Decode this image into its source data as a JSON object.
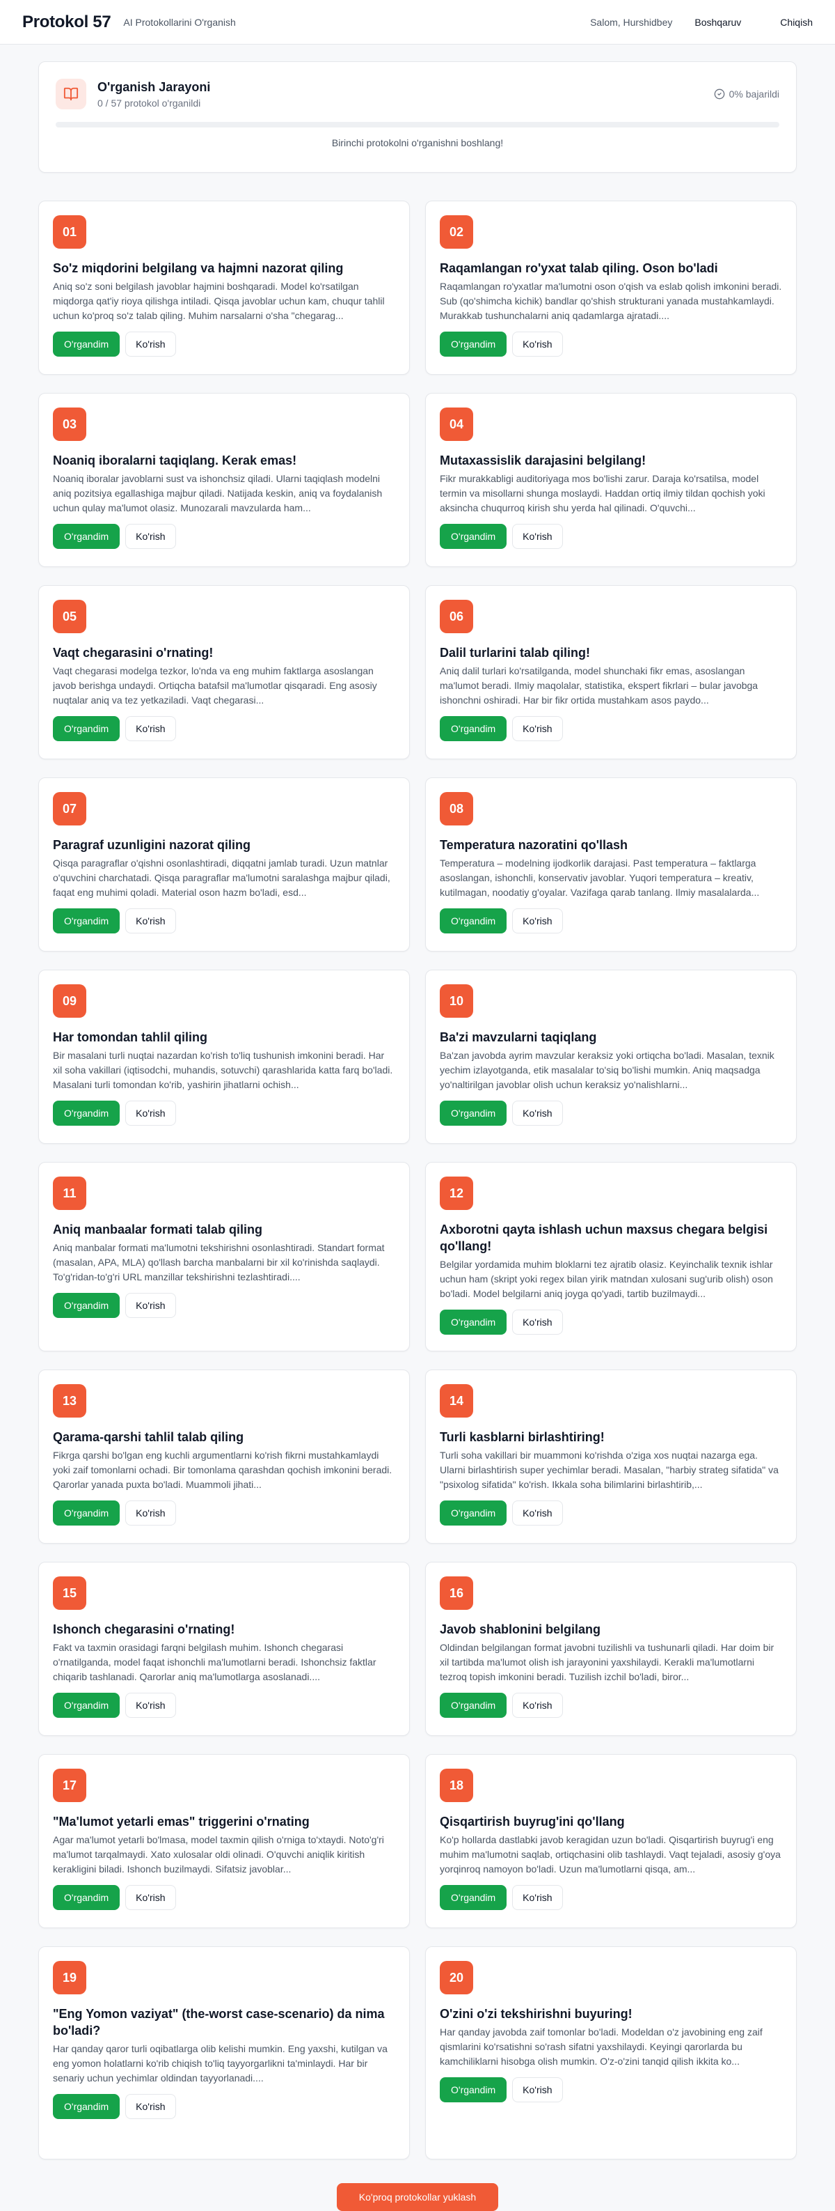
{
  "header": {
    "brand": "Protokol 57",
    "subtitle": "AI Protokollarini O'rganish",
    "greeting": "Salom, Hurshidbey",
    "manage_label": "Boshqaruv",
    "logout_label": "Chiqish"
  },
  "progress": {
    "title": "O'rganish Jarayoni",
    "subtitle": "0 / 57 protokol o'rganildi",
    "percent_label": "0% bajarildi",
    "percent": 0,
    "hint": "Birinchi protokolni o'rganishni boshlang!"
  },
  "actions": {
    "learned_label": "O'rgandim",
    "view_label": "Ko'rish"
  },
  "protocols": [
    {
      "num": "01",
      "title": "So'z miqdorini belgilang va hajmni nazorat qiling",
      "desc": "Aniq so'z soni belgilash javoblar hajmini boshqaradi. Model ko'rsatilgan miqdorga qat'iy rioya qilishga intiladi. Qisqa javoblar uchun kam, chuqur tahlil uchun ko'proq so'z talab qiling. Muhim narsalarni o'sha \"chegarag..."
    },
    {
      "num": "02",
      "title": "Raqamlangan ro'yxat talab qiling. Oson bo'ladi",
      "desc": "Raqamlangan ro'yxatlar ma'lumotni oson o'qish va eslab qolish imkonini beradi. Sub (qo'shimcha kichik) bandlar qo'shish strukturani yanada mustahkamlaydi. Murakkab tushunchalarni aniq qadamlarga ajratadi...."
    },
    {
      "num": "03",
      "title": "Noaniq iboralarni taqiqlang. Kerak emas!",
      "desc": "Noaniq iboralar javoblarni sust va ishonchsiz qiladi. Ularni taqiqlash modelni aniq pozitsiya egallashiga majbur qiladi. Natijada keskin, aniq va foydalanish uchun qulay ma'lumot olasiz. Munozarali mavzularda ham..."
    },
    {
      "num": "04",
      "title": "Mutaxassislik darajasini belgilang!",
      "desc": "Fikr murakkabligi auditoriyaga mos bo'lishi zarur. Daraja ko'rsatilsa, model termin va misollarni shunga moslaydi. Haddan ortiq ilmiy tildan qochish yoki aksincha chuqurroq kirish shu yerda hal qilinadi. O'quvchi..."
    },
    {
      "num": "05",
      "title": "Vaqt chegarasini o'rnating!",
      "desc": "Vaqt chegarasi modelga tezkor, lo'nda va eng muhim faktlarga asoslangan javob berishga undaydi. Ortiqcha batafsil ma'lumotlar qisqaradi. Eng asosiy nuqtalar aniq va tez yetkaziladi. Vaqt chegarasi..."
    },
    {
      "num": "06",
      "title": "Dalil turlarini talab qiling!",
      "desc": "Aniq dalil turlari ko'rsatilganda, model shunchaki fikr emas, asoslangan ma'lumot beradi. Ilmiy maqolalar, statistika, ekspert fikrlari – bular javobga ishonchni oshiradi. Har bir fikr ortida mustahkam asos paydo..."
    },
    {
      "num": "07",
      "title": "Paragraf uzunligini nazorat qiling",
      "desc": "Qisqa paragraflar o'qishni osonlashtiradi, diqqatni jamlab turadi. Uzun matnlar o'quvchini charchatadi. Qisqa paragraflar ma'lumotni saralashga majbur qiladi, faqat eng muhimi qoladi. Material oson hazm bo'ladi, esd..."
    },
    {
      "num": "08",
      "title": "Temperatura nazoratini qo'llash",
      "desc": "Temperatura – modelning ijodkorlik darajasi. Past temperatura – faktlarga asoslangan, ishonchli, konservativ javoblar. Yuqori temperatura – kreativ, kutilmagan, noodatiy g'oyalar. Vazifaga qarab tanlang. Ilmiy masalalarda..."
    },
    {
      "num": "09",
      "title": "Har tomondan tahlil qiling",
      "desc": "Bir masalani turli nuqtai nazardan ko'rish to'liq tushunish imkonini beradi. Har xil soha vakillari (iqtisodchi, muhandis, sotuvchi) qarashlarida katta farq bo'ladi. Masalani turli tomondan ko'rib, yashirin jihatlarni ochish..."
    },
    {
      "num": "10",
      "title": "Ba'zi mavzularni taqiqlang",
      "desc": "Ba'zan javobda ayrim mavzular keraksiz yoki ortiqcha bo'ladi. Masalan, texnik yechim izlayotganda, etik masalalar to'siq bo'lishi mumkin. Aniq maqsadga yo'naltirilgan javoblar olish uchun keraksiz yo'nalishlarni..."
    },
    {
      "num": "11",
      "title": "Aniq manbaalar formati talab qiling",
      "desc": "Aniq manbalar formati ma'lumotni tekshirishni osonlashtiradi. Standart format (masalan, APA, MLA) qo'llash barcha manbalarni bir xil ko'rinishda saqlaydi. To'g'ridan-to'g'ri URL manzillar tekshirishni tezlashtiradi...."
    },
    {
      "num": "12",
      "title": "Axborotni qayta ishlash uchun maxsus chegara belgisi qo'llang!",
      "desc": "Belgilar yordamida muhim bloklarni tez ajratib olasiz. Keyinchalik texnik ishlar uchun ham (skript yoki regex bilan yirik matndan xulosani sug'urib olish) oson bo'ladi. Model belgilarni aniq joyga qo'yadi, tartib buzilmaydi..."
    },
    {
      "num": "13",
      "title": "Qarama-qarshi tahlil talab qiling",
      "desc": "Fikrga qarshi bo'lgan eng kuchli argumentlarni ko'rish fikrni mustahkamlaydi yoki zaif tomonlarni ochadi. Bir tomonlama qarashdan qochish imkonini beradi. Qarorlar yanada puxta bo'ladi. Muammoli jihati..."
    },
    {
      "num": "14",
      "title": "Turli kasblarni birlashtiring!",
      "desc": "Turli soha vakillari bir muammoni ko'rishda o'ziga xos nuqtai nazarga ega. Ularni birlashtirish super yechimlar beradi. Masalan, \"harbiy strateg sifatida\" va \"psixolog sifatida\" ko'rish. Ikkala soha bilimlarini birlashtirib,..."
    },
    {
      "num": "15",
      "title": "Ishonch chegarasini o'rnating!",
      "desc": "Fakt va taxmin orasidagi farqni belgilash muhim. Ishonch chegarasi o'rnatilganda, model faqat ishonchli ma'lumotlarni beradi. Ishonchsiz faktlar chiqarib tashlanadi. Qarorlar aniq ma'lumotlarga asoslanadi...."
    },
    {
      "num": "16",
      "title": "Javob shablonini belgilang",
      "desc": "Oldindan belgilangan format javobni tuzilishli va tushunarli qiladi. Har doim bir xil tartibda ma'lumot olish ish jarayonini yaxshilaydi. Kerakli ma'lumotlarni tezroq topish imkonini beradi. Tuzilish izchil bo'ladi, biror..."
    },
    {
      "num": "17",
      "title": "\"Ma'lumot yetarli emas\" triggerini o'rnating",
      "desc": "Agar ma'lumot yetarli bo'lmasa, model taxmin qilish o'rniga to'xtaydi. Noto'g'ri ma'lumot tarqalmaydi. Xato xulosalar oldi olinadi. O'quvchi aniqlik kiritish kerakligini biladi. Ishonch buzilmaydi. Sifatsiz javoblar..."
    },
    {
      "num": "18",
      "title": "Qisqartirish buyrug'ini qo'llang",
      "desc": "Ko'p hollarda dastlabki javob keragidan uzun bo'ladi. Qisqartirish buyrug'i eng muhim ma'lumotni saqlab, ortiqchasini olib tashlaydi. Vaqt tejaladi, asosiy g'oya yorqinroq namoyon bo'ladi. Uzun ma'lumotlarni qisqa, am..."
    },
    {
      "num": "19",
      "title": "\"Eng Yomon vaziyat\" (the-worst case-scenario) da nima bo'ladi?",
      "desc": "Har qanday qaror turli oqibatlarga olib kelishi mumkin. Eng yaxshi, kutilgan va eng yomon holatlarni ko'rib chiqish to'liq tayyorgarlikni ta'minlaydi. Har bir senariy uchun yechimlar oldindan tayyorlanadi...."
    },
    {
      "num": "20",
      "title": "O'zini o'zi tekshirishni buyuring!",
      "desc": "Har qanday javobda zaif tomonlar bo'ladi. Modeldan o'z javobining eng zaif qismlarini ko'rsatishni so'rash sifatni yaxshilaydi. Keyingi qarorlarda bu kamchiliklarni hisobga olish mumkin. O'z-o'zini tanqid qilish ikkita ko..."
    }
  ],
  "load_more_label": "Ko'proq protokollar yuklash",
  "colors": {
    "accent": "#f05a36",
    "success": "#16a34a"
  }
}
